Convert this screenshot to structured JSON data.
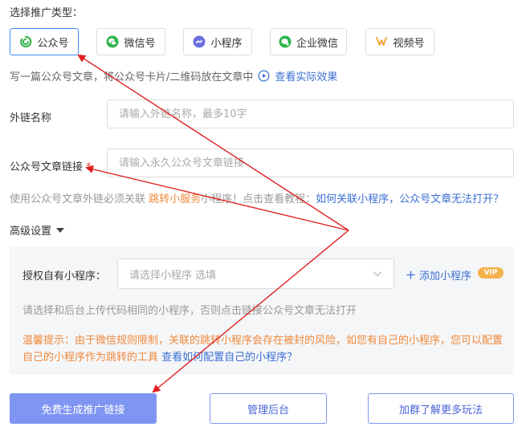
{
  "section_title": "选择推广类型：",
  "types": [
    {
      "label": "公众号",
      "icon": "official-account-icon",
      "active": true
    },
    {
      "label": "微信号",
      "icon": "wechat-icon",
      "active": false
    },
    {
      "label": "小程序",
      "icon": "mini-program-icon",
      "active": false
    },
    {
      "label": "企业微信",
      "icon": "work-wechat-icon",
      "active": false
    },
    {
      "label": "视频号",
      "icon": "channels-icon",
      "active": false
    }
  ],
  "hint": {
    "text": "写一篇公众号文章，将公众号卡片/二维码放在文章中",
    "link": "查看实际效果"
  },
  "fields": {
    "name_label": "外链名称",
    "name_placeholder": "请输入外链名称，最多10字",
    "url_label": "公众号文章链接",
    "url_required": "*",
    "url_placeholder": "请输入永久公众号文章链接"
  },
  "tip": {
    "prefix": "使用公众号文章外链必须关联 ",
    "highlight": "跳转小服务",
    "middle": "小程序！点击查看教程：",
    "link": "如何关联小程序，公众号文章无法打开？"
  },
  "advanced": {
    "label": "高级设置",
    "auth_label": "授权自有小程序：",
    "select_placeholder": "请选择小程序  选填",
    "add_link": "添加小程序",
    "vip_badge": "VIP",
    "note": "请选择和后台上传代码相同的小程序，否则点击链接公众号文章无法打开",
    "warm_text": "温馨提示：由于微信规则限制，关联的跳转小程序会存在被封的风险，如您有自己的小程序，您可以配置自己的小程序作为跳转的工具 ",
    "warm_link": "查看如何配置自己的小程序？"
  },
  "buttons": {
    "generate": "免费生成推广链接",
    "manage": "管理后台",
    "group": "加群了解更多玩法"
  },
  "colors": {
    "accent_blue": "#3b6fd4",
    "primary_button": "#7f95f2",
    "warning_orange": "#f0883b",
    "arrow_red": "#e02020"
  }
}
